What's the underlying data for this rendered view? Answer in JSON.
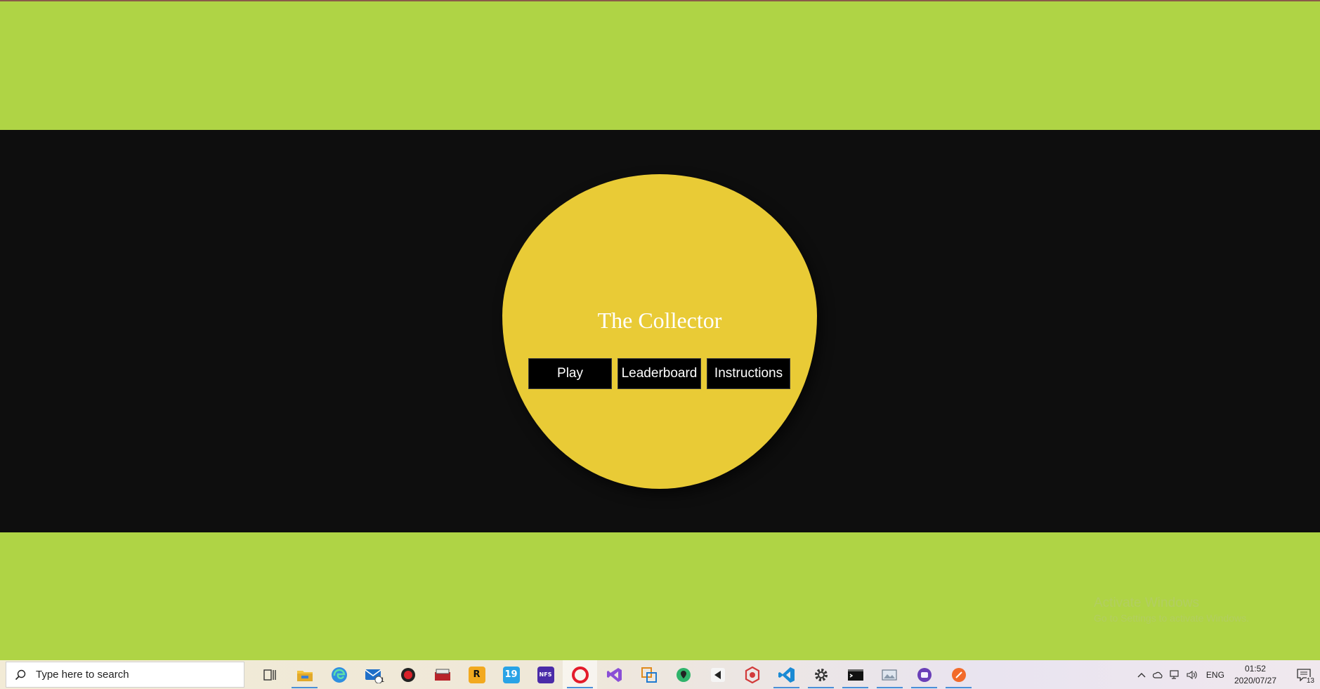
{
  "game": {
    "title": "The Collector",
    "buttons": {
      "play": "Play",
      "leaderboard": "Leaderboard",
      "instructions": "Instructions"
    },
    "colors": {
      "background": "#afd445",
      "band": "#0e0e0e",
      "blob": "#e9cb36",
      "button": "#000000"
    }
  },
  "watermark": {
    "title": "Activate Windows",
    "subtitle": "Go to Settings to activate Windows."
  },
  "taskbar": {
    "search_placeholder": "Type here to search",
    "apps": [
      "task-view",
      "file-explorer",
      "edge",
      "mail",
      "app-red-circle",
      "media-app",
      "rockstar",
      "app-19",
      "nfs",
      "opera",
      "visual-studio",
      "layers-app",
      "maps-pin-app",
      "unity",
      "hex-app",
      "vscode",
      "settings",
      "terminal",
      "photos",
      "purple-app",
      "orange-app"
    ],
    "mail_badge": "1",
    "tray": {
      "language": "ENG",
      "time": "01:52",
      "date": "2020/07/27",
      "notification_count": "13"
    }
  }
}
